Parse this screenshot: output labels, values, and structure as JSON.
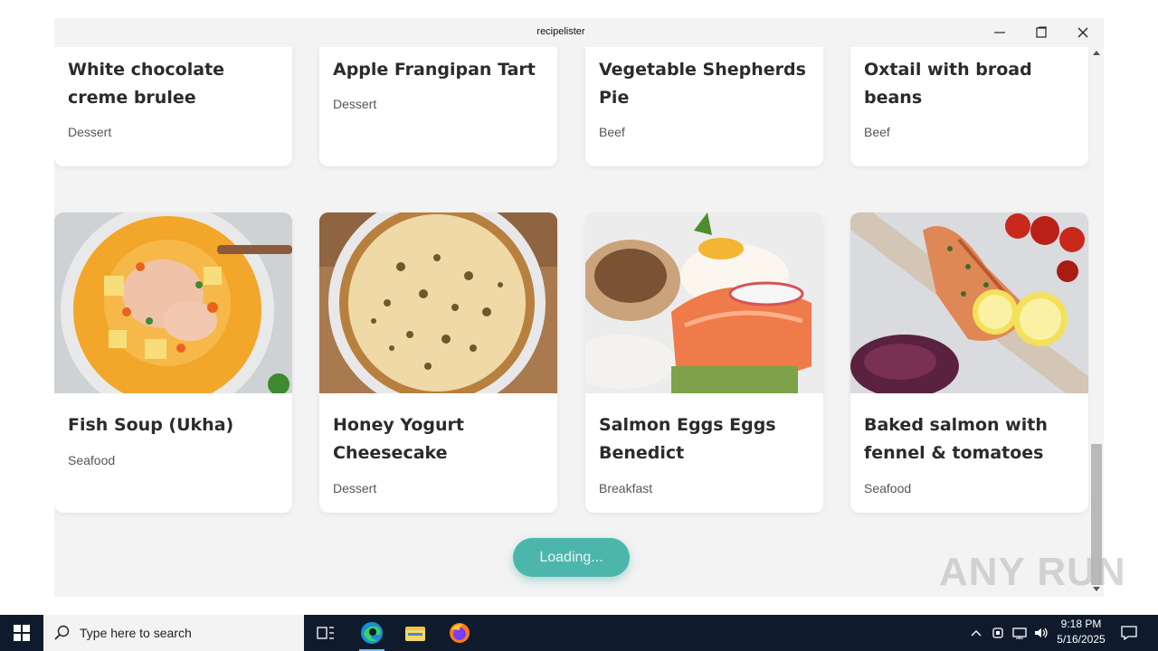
{
  "window": {
    "title": "recipelister"
  },
  "cards_top": [
    {
      "title": "White chocolate creme brulee",
      "category": "Dessert"
    },
    {
      "title": "Apple Frangipan Tart",
      "category": "Dessert"
    },
    {
      "title": "Vegetable Shepherds Pie",
      "category": "Beef"
    },
    {
      "title": "Oxtail with broad beans",
      "category": "Beef"
    }
  ],
  "cards": [
    {
      "title": "Fish Soup (Ukha)",
      "category": "Seafood",
      "image": "fish-soup-image"
    },
    {
      "title": "Honey Yogurt Cheesecake",
      "category": "Dessert",
      "image": "cheesecake-image"
    },
    {
      "title": "Salmon Eggs Eggs Benedict",
      "category": "Breakfast",
      "image": "eggs-benedict-image"
    },
    {
      "title": "Baked salmon with fennel & tomatoes",
      "category": "Seafood",
      "image": "baked-salmon-image"
    }
  ],
  "loading_button": {
    "label": "Loading..."
  },
  "watermark": {
    "text": "ANY RUN"
  },
  "taskbar": {
    "search_placeholder": "Type here to search",
    "time": "9:18 PM",
    "date": "5/16/2025"
  },
  "colors": {
    "accent": "#4db6ac",
    "taskbar": "#0f1b2d",
    "background": "#f3f3f3"
  }
}
